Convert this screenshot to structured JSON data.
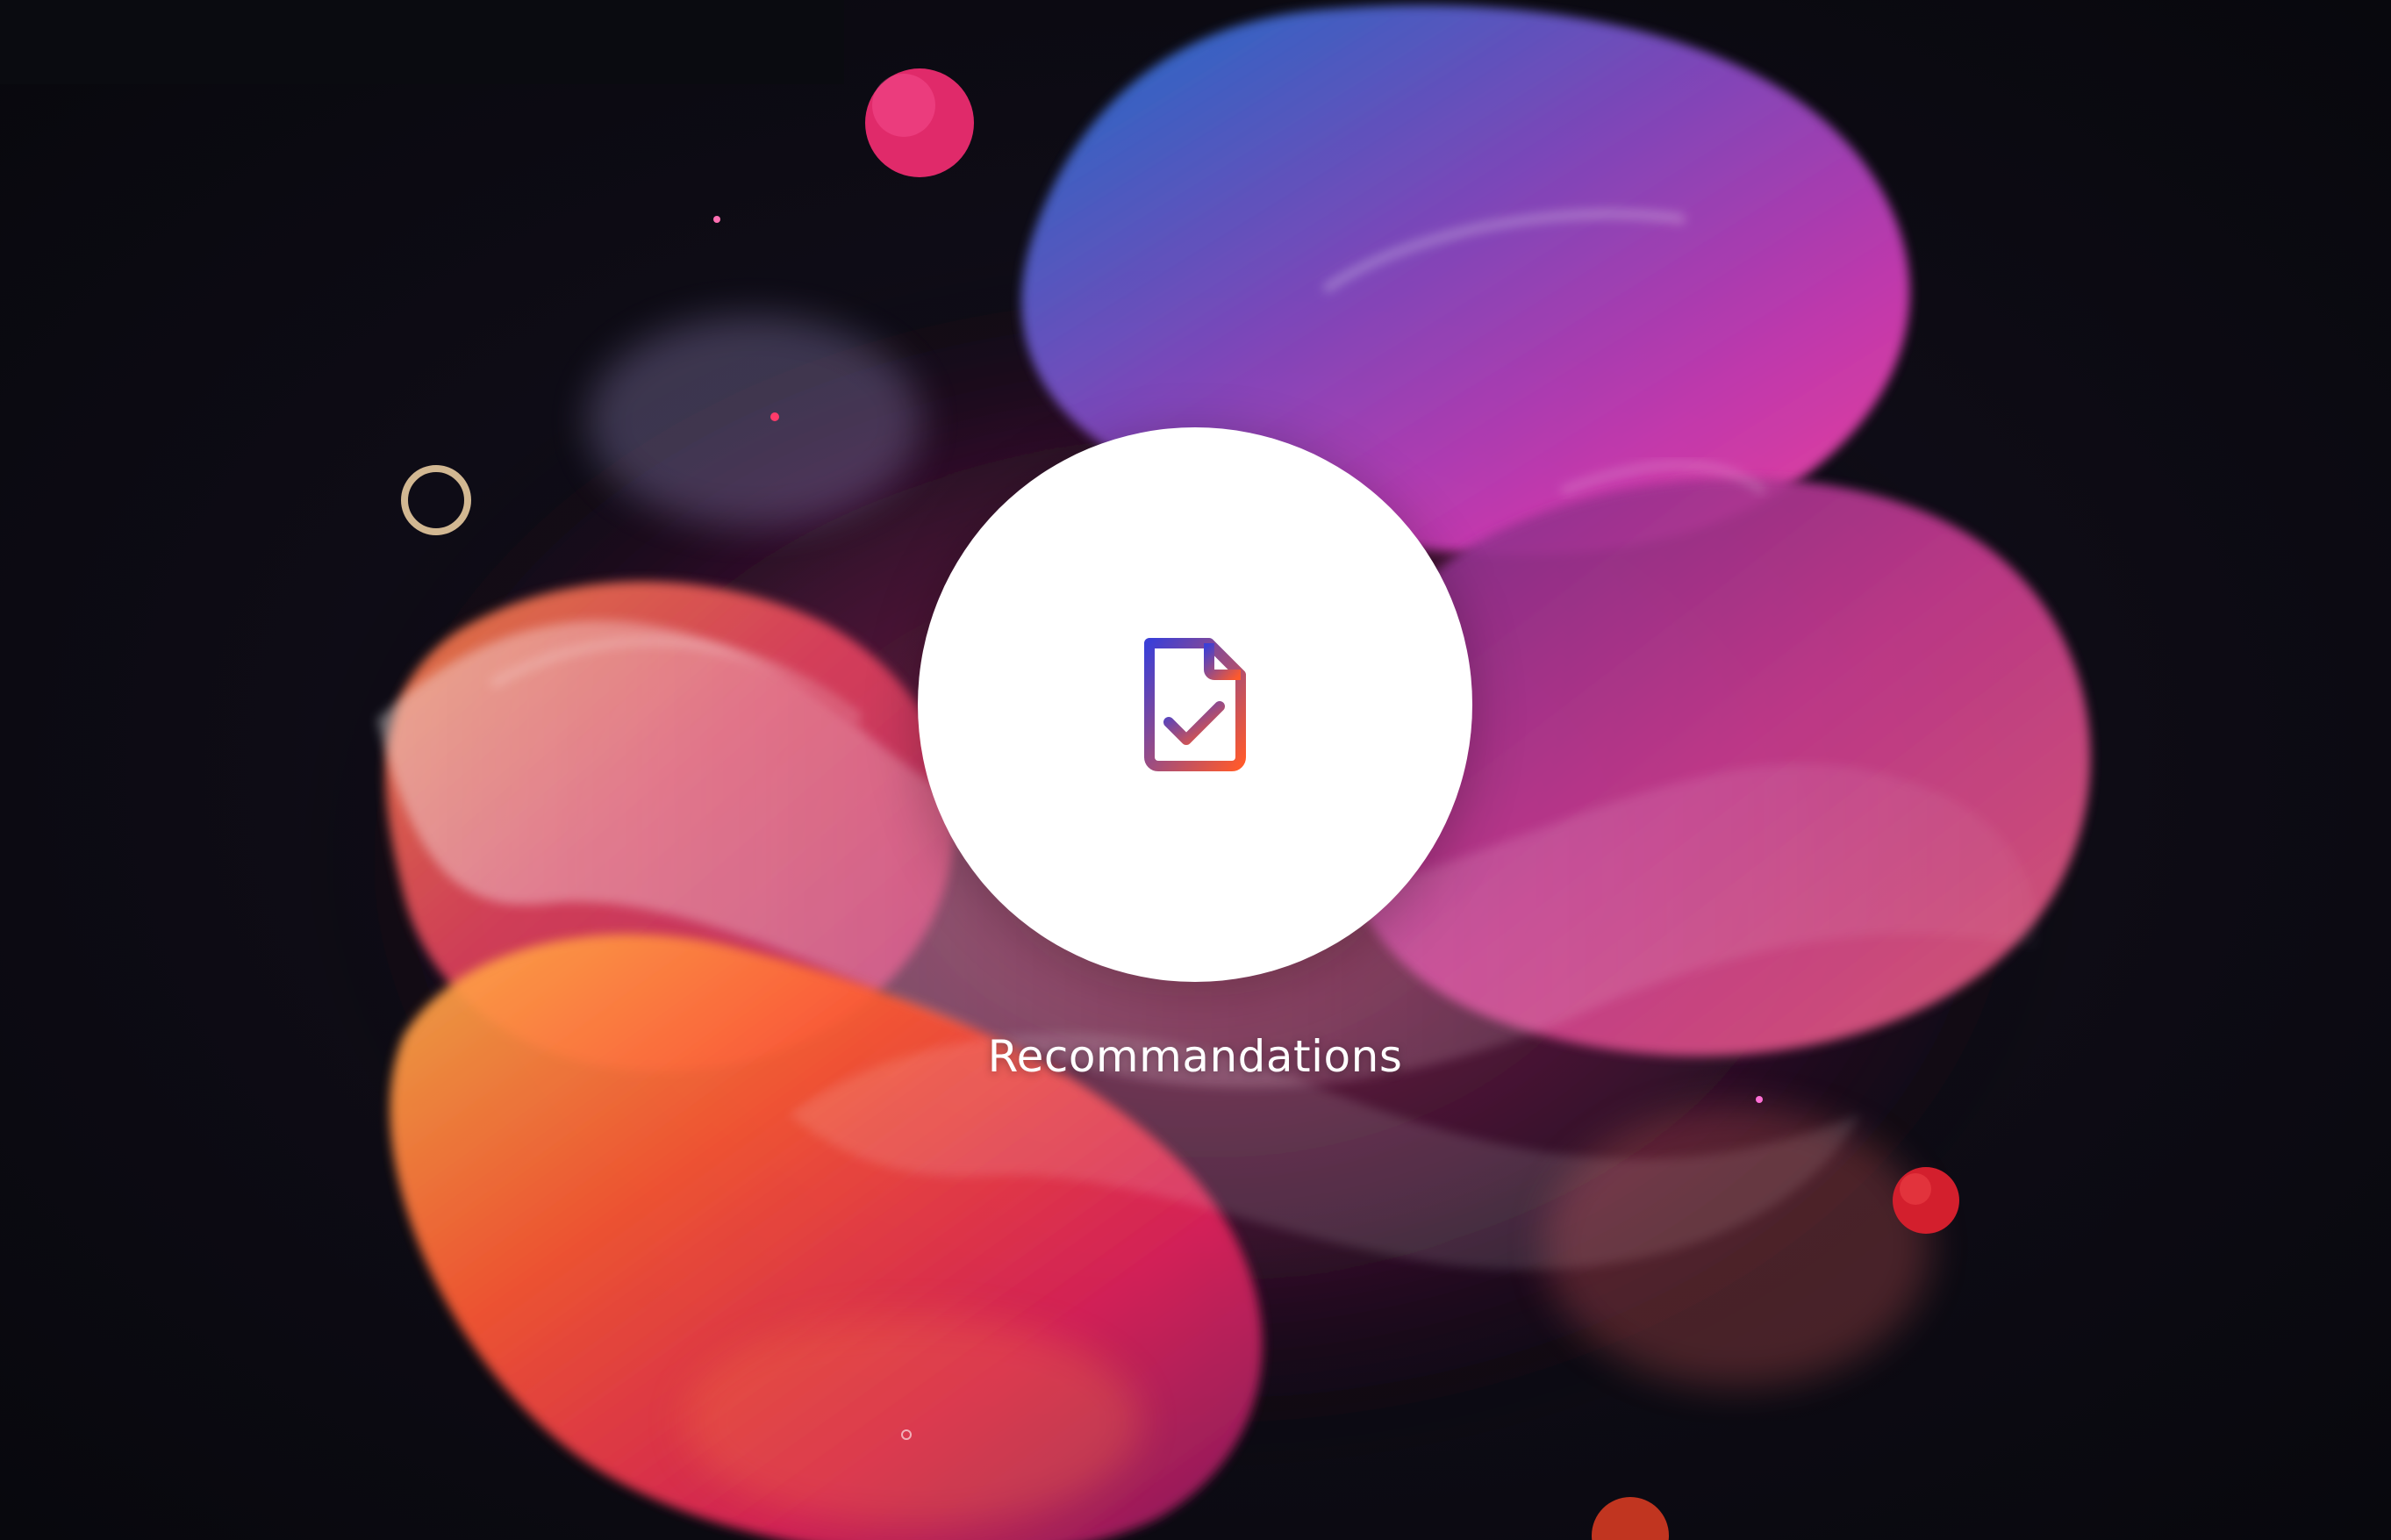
{
  "main": {
    "label": "Recommandations"
  },
  "icons": {
    "center": "document-check-icon"
  },
  "colors": {
    "page_background": "#0b0b12",
    "button_background": "#ffffff",
    "icon_gradient_start": "#3b3fd6",
    "icon_gradient_end": "#ff5a2b",
    "label": "#ffffff"
  }
}
